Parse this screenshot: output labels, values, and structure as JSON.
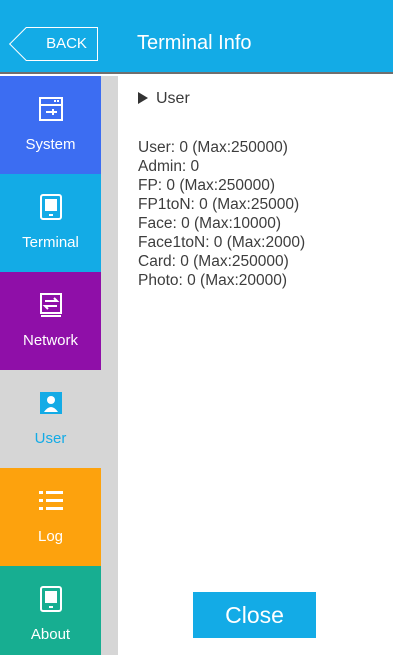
{
  "header": {
    "back_label": "BACK",
    "title": "Terminal Info"
  },
  "sidebar": {
    "items": [
      {
        "label": "System",
        "icon": "system-icon",
        "color": "#3c6df2"
      },
      {
        "label": "Terminal",
        "icon": "terminal-icon",
        "color": "#13abe6"
      },
      {
        "label": "Network",
        "icon": "network-icon",
        "color": "#8f0fa8"
      },
      {
        "label": "User",
        "icon": "user-icon",
        "color": "#d6d6d6",
        "active": true
      },
      {
        "label": "Log",
        "icon": "log-icon",
        "color": "#fda20d"
      },
      {
        "label": "About",
        "icon": "about-icon",
        "color": "#17ae91"
      }
    ]
  },
  "content": {
    "section_title": "User",
    "lines": [
      "User: 0 (Max:250000)",
      "Admin: 0",
      "FP: 0 (Max:250000)",
      "FP1toN: 0 (Max:25000)",
      "Face: 0 (Max:10000)",
      "Face1toN: 0 (Max:2000)",
      "Card: 0 (Max:250000)",
      "Photo: 0 (Max:20000)"
    ]
  },
  "footer": {
    "close_label": "Close"
  },
  "colors": {
    "accent": "#13abe6",
    "sidebar_bg": "#d6d6d6"
  }
}
